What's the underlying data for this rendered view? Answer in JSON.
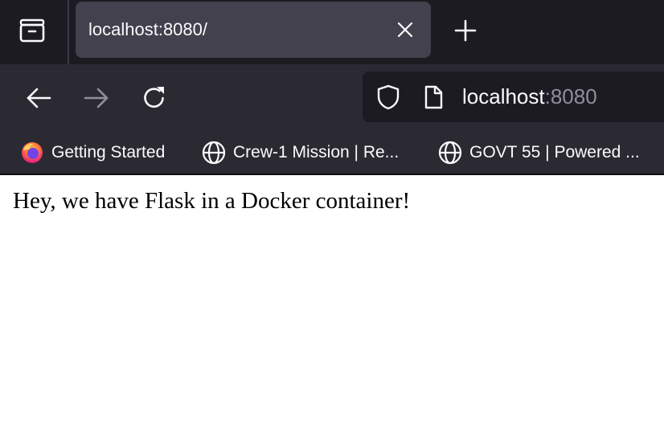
{
  "tab": {
    "title": "localhost:8080/"
  },
  "toolbar": {
    "back_icon": "arrow-left-icon",
    "forward_icon": "arrow-right-icon",
    "reload_icon": "reload-icon",
    "new_tab_icon": "plus-icon",
    "tab_list_icon": "tab-list-icon",
    "close_tab_icon": "close-icon"
  },
  "urlbar": {
    "host": "localhost",
    "port": ":8080",
    "security_icon": "shield-icon",
    "page_icon": "document-icon"
  },
  "bookmarks": [
    {
      "label": "Getting Started",
      "icon": "firefox-icon"
    },
    {
      "label": "Crew-1 Mission | Re...",
      "icon": "globe-icon"
    },
    {
      "label": "GOVT 55 | Powered ...",
      "icon": "globe-icon"
    }
  ],
  "page": {
    "text": "Hey, we have Flask in a Docker container!"
  },
  "colors": {
    "tabstrip_bg": "#1c1b22",
    "toolbar_bg": "#2b2a33",
    "selected_tab_bg": "#42414d",
    "text_primary": "#fbfbfe",
    "text_muted": "#8f8f9d",
    "page_bg": "#ffffff"
  }
}
